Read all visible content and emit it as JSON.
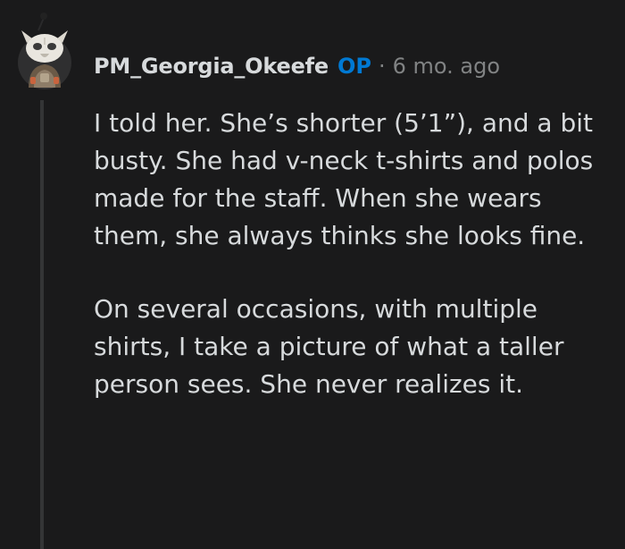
{
  "comment": {
    "author": "PM_Georgia_Okeefe",
    "op_badge": "OP",
    "separator": "·",
    "timestamp": "6 mo. ago",
    "avatar_icon": "snoo-avatar-icon",
    "paragraphs": [
      "I told her. She’s shorter (5’1”), and a bit busty. She had v-neck t-shirts and polos made for the staff. When she wears them, she always thinks she looks fine.",
      "On several occasions, with multiple shirts, I take a picture of what a taller person sees. She never realizes it."
    ]
  },
  "colors": {
    "background": "#1a1a1b",
    "text": "#d7dadc",
    "meta": "#818384",
    "op": "#0079d3",
    "thread_line": "#343536"
  }
}
